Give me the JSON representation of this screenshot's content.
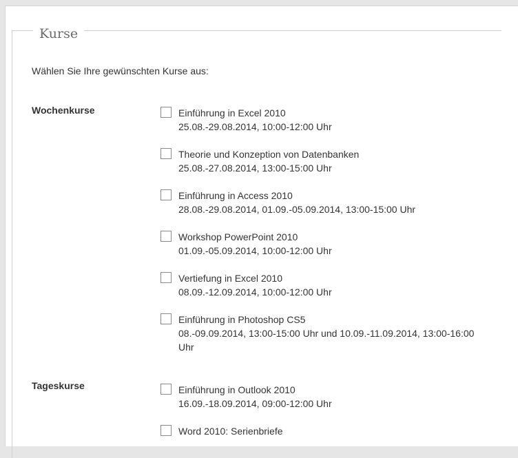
{
  "form": {
    "legend": "Kurse",
    "intro": "Wählen Sie Ihre gewünschten Kurse aus:"
  },
  "sections": [
    {
      "label": "Wochenkurse",
      "courses": [
        {
          "title": "Einführung in Excel 2010",
          "dates": "25.08.-29.08.2014, 10:00-12:00 Uhr",
          "checked": false
        },
        {
          "title": "Theorie und Konzeption von Datenbanken",
          "dates": "25.08.-27.08.2014, 13:00-15:00 Uhr",
          "checked": false
        },
        {
          "title": "Einführung in Access 2010",
          "dates": "28.08.-29.08.2014, 01.09.-05.09.2014, 13:00-15:00 Uhr",
          "checked": false
        },
        {
          "title": "Workshop PowerPoint 2010",
          "dates": "01.09.-05.09.2014, 10:00-12:00 Uhr",
          "checked": false
        },
        {
          "title": "Vertiefung in Excel 2010",
          "dates": "08.09.-12.09.2014, 10:00-12:00 Uhr",
          "checked": false
        },
        {
          "title": "Einführung in Photoshop CS5",
          "dates": "08.-09.09.2014, 13:00-15:00 Uhr und 10.09.-11.09.2014, 13:00-16:00 Uhr",
          "checked": false
        }
      ]
    },
    {
      "label": "Tageskurse",
      "courses": [
        {
          "title": "Einführung in Outlook 2010",
          "dates": "16.09.-18.09.2014, 09:00-12:00 Uhr",
          "checked": false
        },
        {
          "title": "Word 2010: Serienbriefe",
          "dates": "",
          "checked": false
        }
      ]
    }
  ]
}
